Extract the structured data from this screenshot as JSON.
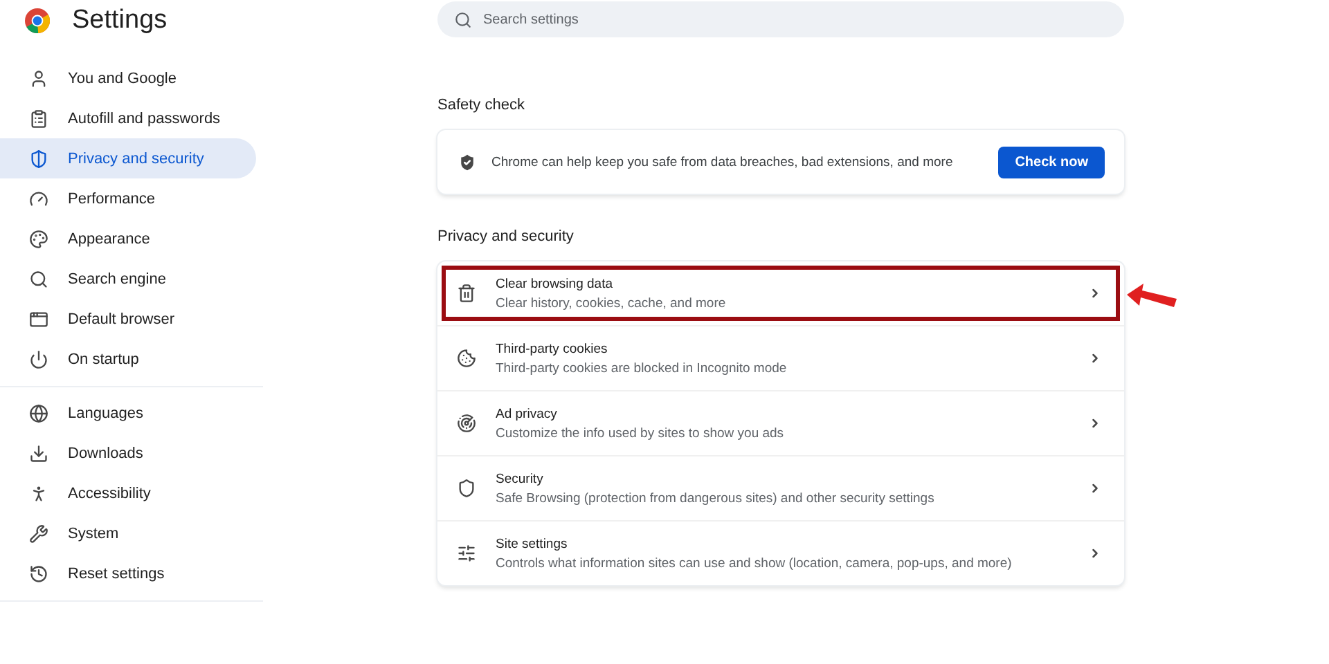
{
  "app": {
    "title": "Settings"
  },
  "sidebar": {
    "groups": [
      [
        {
          "label": "You and Google",
          "selected": false
        },
        {
          "label": "Autofill and passwords",
          "selected": false
        },
        {
          "label": "Privacy and security",
          "selected": true
        },
        {
          "label": "Performance",
          "selected": false
        },
        {
          "label": "Appearance",
          "selected": false
        },
        {
          "label": "Search engine",
          "selected": false
        },
        {
          "label": "Default browser",
          "selected": false
        },
        {
          "label": "On startup",
          "selected": false
        }
      ],
      [
        {
          "label": "Languages",
          "selected": false
        },
        {
          "label": "Downloads",
          "selected": false
        },
        {
          "label": "Accessibility",
          "selected": false
        },
        {
          "label": "System",
          "selected": false
        },
        {
          "label": "Reset settings",
          "selected": false
        }
      ]
    ]
  },
  "search": {
    "placeholder": "Search settings"
  },
  "safety_check": {
    "heading": "Safety check",
    "text": "Chrome can help keep you safe from data breaches, bad extensions, and more",
    "button": "Check now"
  },
  "privacy": {
    "heading": "Privacy and security",
    "rows": [
      {
        "title": "Clear browsing data",
        "subtitle": "Clear history, cookies, cache, and more",
        "highlighted": true
      },
      {
        "title": "Third-party cookies",
        "subtitle": "Third-party cookies are blocked in Incognito mode",
        "highlighted": false
      },
      {
        "title": "Ad privacy",
        "subtitle": "Customize the info used by sites to show you ads",
        "highlighted": false
      },
      {
        "title": "Security",
        "subtitle": "Safe Browsing (protection from dangerous sites) and other security settings",
        "highlighted": false
      },
      {
        "title": "Site settings",
        "subtitle": "Controls what information sites can use and show (location, camera, pop-ups, and more)",
        "highlighted": false
      }
    ]
  }
}
